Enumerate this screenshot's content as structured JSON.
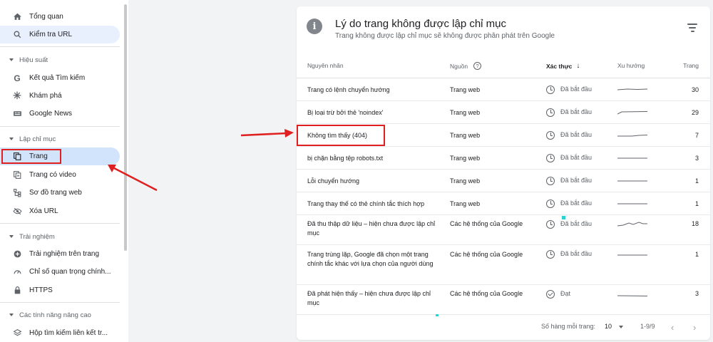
{
  "sidebar": {
    "items": [
      {
        "label": "Tổng quan",
        "icon": "home-icon"
      },
      {
        "label": "Kiểm tra URL",
        "icon": "search-icon"
      },
      {
        "label": "Kết quả Tìm kiếm",
        "icon": "google-g-icon"
      },
      {
        "label": "Khám phá",
        "icon": "asterisk-icon"
      },
      {
        "label": "Google News",
        "icon": "news-icon"
      },
      {
        "label": "Trang",
        "icon": "pages-icon"
      },
      {
        "label": "Trang có video",
        "icon": "video-page-icon"
      },
      {
        "label": "Sơ đồ trang web",
        "icon": "sitemap-icon"
      },
      {
        "label": "Xóa URL",
        "icon": "eye-off-icon"
      },
      {
        "label": "Trải nghiệm trên trang",
        "icon": "plus-circle-icon"
      },
      {
        "label": "Chỉ số quan trọng chính...",
        "icon": "gauge-icon"
      },
      {
        "label": "HTTPS",
        "icon": "lock-icon"
      },
      {
        "label": "Hộp tìm kiếm liên kết tr...",
        "icon": "layers-icon"
      }
    ],
    "sections": [
      "Hiệu suất",
      "Lập chỉ mục",
      "Trải nghiệm",
      "Các tính năng nâng cao"
    ]
  },
  "card": {
    "title": "Lý do trang không được lập chỉ mục",
    "subtitle": "Trang không được lập chỉ mục sẽ không được phân phát trên Google",
    "columns": {
      "reason": "Nguyên nhân",
      "source": "Nguồn",
      "validation": "Xác thực",
      "trend": "Xu hướng",
      "pages": "Trang"
    },
    "rows": [
      {
        "reason": "Trang có lệnh chuyển hướng",
        "source": "Trang web",
        "validation": "Đã bắt đầu",
        "status": "clock",
        "pages": "30"
      },
      {
        "reason": "Bị loại trừ bởi thẻ 'noindex'",
        "source": "Trang web",
        "validation": "Đã bắt đầu",
        "status": "clock",
        "pages": "29"
      },
      {
        "reason": "Không tìm thấy (404)",
        "source": "Trang web",
        "validation": "Đã bắt đầu",
        "status": "clock",
        "pages": "7"
      },
      {
        "reason": "bị chặn bằng tệp robots.txt",
        "source": "Trang web",
        "validation": "Đã bắt đầu",
        "status": "clock",
        "pages": "3"
      },
      {
        "reason": "Lỗi chuyển hướng",
        "source": "Trang web",
        "validation": "Đã bắt đầu",
        "status": "clock",
        "pages": "1"
      },
      {
        "reason": "Trang thay thế có thẻ chính tắc thích hợp",
        "source": "Trang web",
        "validation": "Đã bắt đầu",
        "status": "clock",
        "pages": "1"
      },
      {
        "reason": "Đã thu thập dữ liệu – hiện chưa được lập chỉ mục",
        "source": "Các hệ thống của Google",
        "validation": "Đã bắt đầu",
        "status": "clock",
        "pages": "18"
      },
      {
        "reason": "Trang trùng lặp, Google đã chọn một trang chính tắc khác với lựa chọn của người dùng",
        "source": "Các hệ thống của Google",
        "validation": "Đã bắt đầu",
        "status": "clock",
        "pages": "1"
      },
      {
        "reason": "Đã phát hiện thấy – hiện chưa được lập chỉ mục",
        "source": "Các hệ thống của Google",
        "validation": "Đạt",
        "status": "check",
        "pages": "3"
      }
    ],
    "footer": {
      "rows_per_page_label": "Số hàng mỗi trang:",
      "rows_per_page": "10",
      "range": "1-9/9",
      "prev": "‹",
      "next": "›"
    }
  }
}
